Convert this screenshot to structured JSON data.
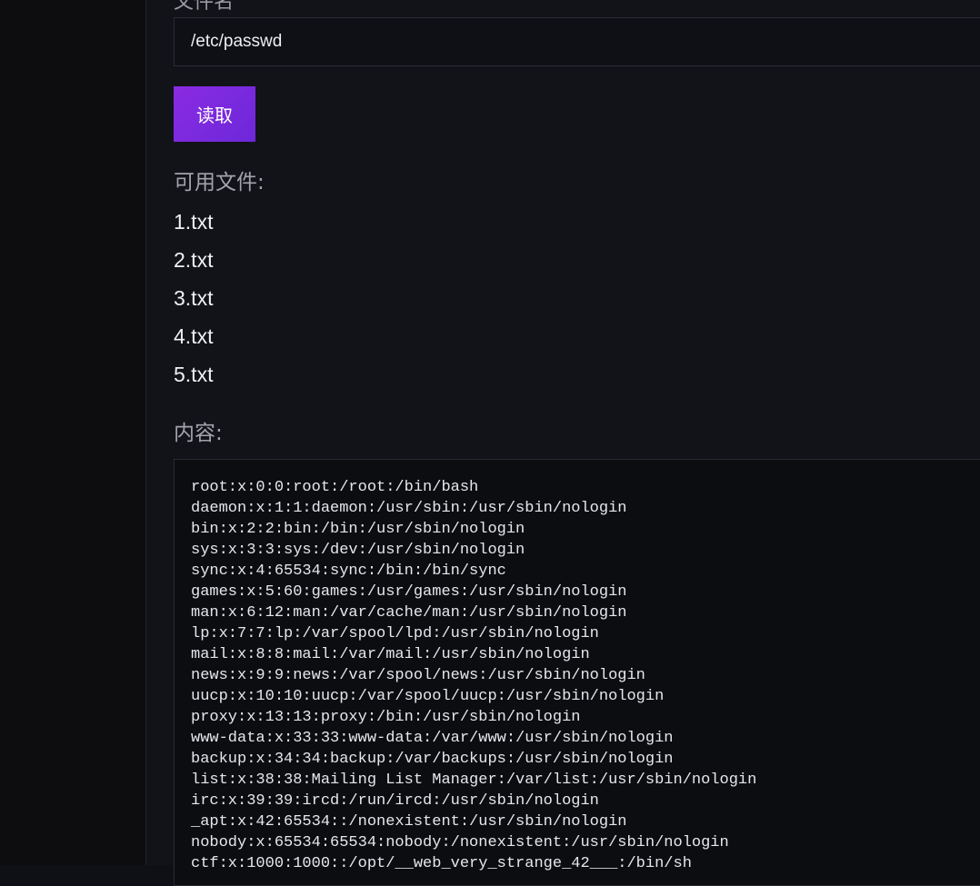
{
  "form": {
    "file_label": "文件名",
    "file_value": "/etc/passwd",
    "read_label": "读取"
  },
  "files": {
    "title": "可用文件:",
    "items": [
      "1.txt",
      "2.txt",
      "3.txt",
      "4.txt",
      "5.txt"
    ]
  },
  "content": {
    "title": "内容:",
    "text": "root:x:0:0:root:/root:/bin/bash\ndaemon:x:1:1:daemon:/usr/sbin:/usr/sbin/nologin\nbin:x:2:2:bin:/bin:/usr/sbin/nologin\nsys:x:3:3:sys:/dev:/usr/sbin/nologin\nsync:x:4:65534:sync:/bin:/bin/sync\ngames:x:5:60:games:/usr/games:/usr/sbin/nologin\nman:x:6:12:man:/var/cache/man:/usr/sbin/nologin\nlp:x:7:7:lp:/var/spool/lpd:/usr/sbin/nologin\nmail:x:8:8:mail:/var/mail:/usr/sbin/nologin\nnews:x:9:9:news:/var/spool/news:/usr/sbin/nologin\nuucp:x:10:10:uucp:/var/spool/uucp:/usr/sbin/nologin\nproxy:x:13:13:proxy:/bin:/usr/sbin/nologin\nwww-data:x:33:33:www-data:/var/www:/usr/sbin/nologin\nbackup:x:34:34:backup:/var/backups:/usr/sbin/nologin\nlist:x:38:38:Mailing List Manager:/var/list:/usr/sbin/nologin\nirc:x:39:39:ircd:/run/ircd:/usr/sbin/nologin\n_apt:x:42:65534::/nonexistent:/usr/sbin/nologin\nnobody:x:65534:65534:nobody:/nonexistent:/usr/sbin/nologin\nctf:x:1000:1000::/opt/__web_very_strange_42___:/bin/sh"
  },
  "colors": {
    "accent": "#8a2be2",
    "background": "#121319"
  }
}
